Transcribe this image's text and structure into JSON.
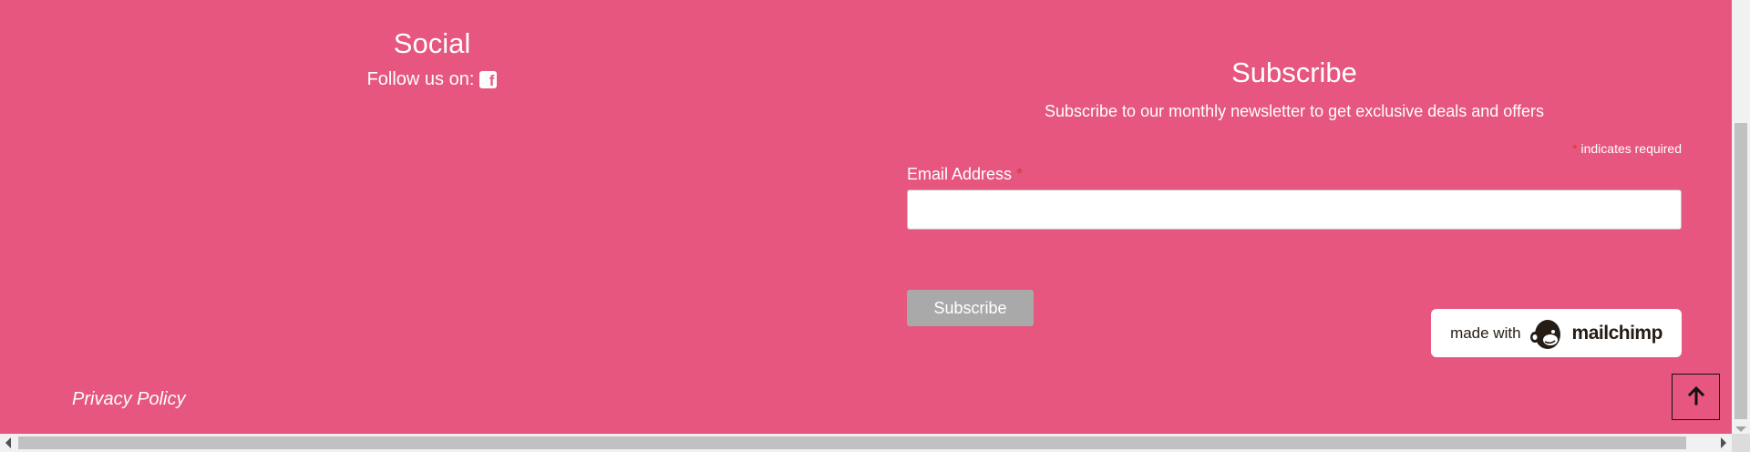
{
  "social": {
    "heading": "Social",
    "follow_text": "Follow us on:",
    "icon": "facebook-icon"
  },
  "subscribe": {
    "heading": "Subscribe",
    "lead": "Subscribe to our monthly newsletter to get exclusive deals and offers",
    "required_asterisk": "*",
    "required_note": "indicates required",
    "email_label": "Email Address",
    "email_value": "",
    "button_label": "Subscribe"
  },
  "badge": {
    "made_with": "made with",
    "brand": "mailchimp"
  },
  "footer": {
    "privacy_label": "Privacy Policy",
    "back_to_top_icon": "arrow-up-icon"
  },
  "colors": {
    "background": "#e6567e",
    "button_disabled": "#a9a9a9",
    "required": "#d33d3d"
  }
}
